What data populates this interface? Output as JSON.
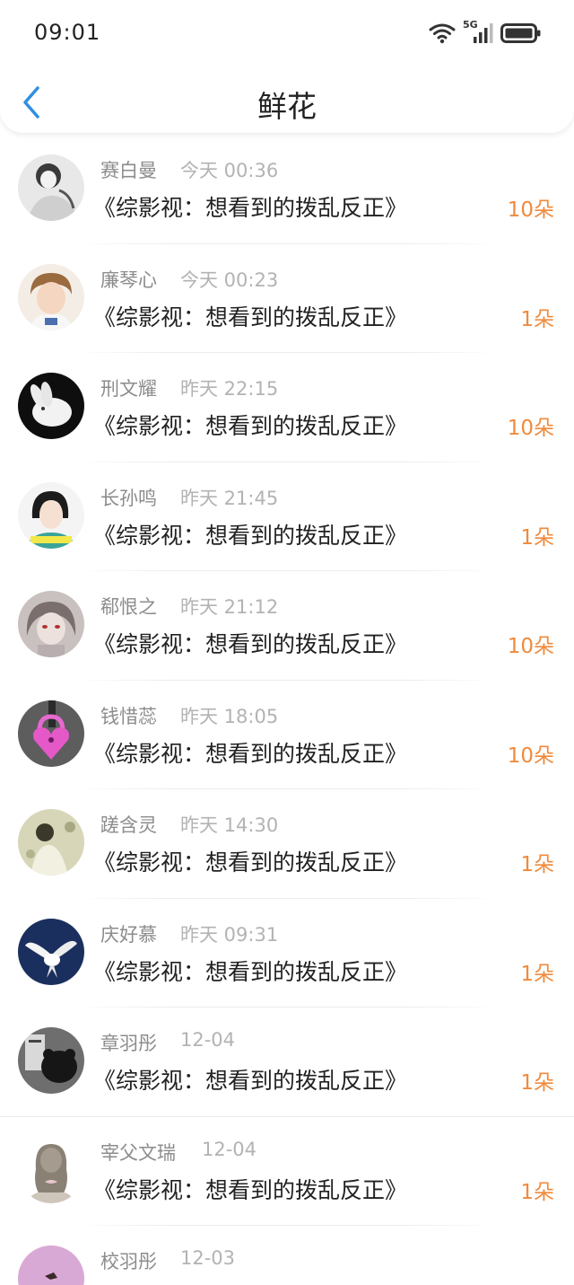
{
  "status_bar": {
    "time": "09:01",
    "network_label": "5G",
    "icons": [
      "wifi-icon",
      "signal-icon",
      "battery-icon"
    ]
  },
  "header": {
    "back_icon": "chevron-left-icon",
    "title": "鲜花"
  },
  "colors": {
    "accent_blue": "#2f8fe0",
    "amount_orange": "#f08a3c",
    "name_gray": "#8c8c8c",
    "time_gray": "#b3b3b3"
  },
  "items": [
    {
      "name": "赛白曼",
      "time": "今天 00:36",
      "book": "《综影视：想看到的拨乱反正》",
      "amount": "10朵"
    },
    {
      "name": "廉琴心",
      "time": "今天 00:23",
      "book": "《综影视：想看到的拨乱反正》",
      "amount": "1朵"
    },
    {
      "name": "刑文耀",
      "time": "昨天 22:15",
      "book": "《综影视：想看到的拨乱反正》",
      "amount": "10朵"
    },
    {
      "name": "长孙鸣",
      "time": "昨天 21:45",
      "book": "《综影视：想看到的拨乱反正》",
      "amount": "1朵"
    },
    {
      "name": "郗恨之",
      "time": "昨天 21:12",
      "book": "《综影视：想看到的拨乱反正》",
      "amount": "10朵"
    },
    {
      "name": "钱惜蕊",
      "time": "昨天 18:05",
      "book": "《综影视：想看到的拨乱反正》",
      "amount": "10朵"
    },
    {
      "name": "蹉含灵",
      "time": "昨天 14:30",
      "book": "《综影视：想看到的拨乱反正》",
      "amount": "1朵"
    },
    {
      "name": "庆好慕",
      "time": "昨天 09:31",
      "book": "《综影视：想看到的拨乱反正》",
      "amount": "1朵"
    },
    {
      "name": "章羽彤",
      "time": "12-04",
      "book": "《综影视：想看到的拨乱反正》",
      "amount": "1朵"
    },
    {
      "name": "宰父文瑞",
      "time": "12-04",
      "book": "《综影视：想看到的拨乱反正》",
      "amount": "1朵"
    },
    {
      "name": "校羽彤",
      "time": "12-03",
      "book": "",
      "amount": ""
    }
  ]
}
